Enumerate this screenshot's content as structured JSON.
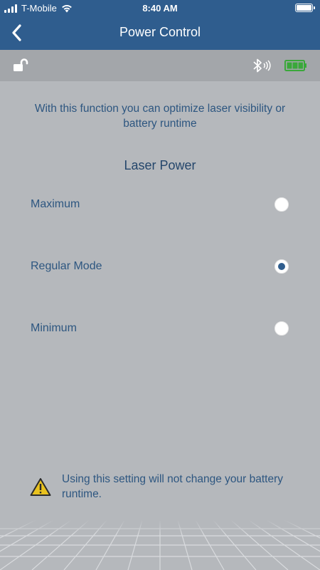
{
  "status_bar": {
    "carrier": "T-Mobile",
    "time": "8:40 AM",
    "wifi_icon": "wifi-icon",
    "signal_icon": "signal-bars-icon",
    "battery_icon": "battery-icon"
  },
  "nav": {
    "title": "Power Control",
    "back_icon": "chevron-left-icon"
  },
  "device_bar": {
    "lock_icon": "unlocked-padlock-icon",
    "bluetooth_icon": "bluetooth-icon",
    "battery_icon": "device-battery-full-icon",
    "battery_color": "#3aa83a"
  },
  "content": {
    "description": "With this function you can optimize laser visibility or battery runtime",
    "section_title": "Laser Power",
    "options": [
      {
        "label": "Maximum",
        "selected": false
      },
      {
        "label": "Regular Mode",
        "selected": true
      },
      {
        "label": "Minimum",
        "selected": false
      }
    ],
    "warning": "Using this setting will not change your battery runtime.",
    "warning_icon": "warning-triangle-icon"
  },
  "colors": {
    "header_blue": "#2f5d8e",
    "background_gray": "#b5b8bc",
    "device_bar_gray": "#a3a6aa",
    "text_blue": "#2d5680",
    "warning_yellow": "#e9c21f"
  }
}
